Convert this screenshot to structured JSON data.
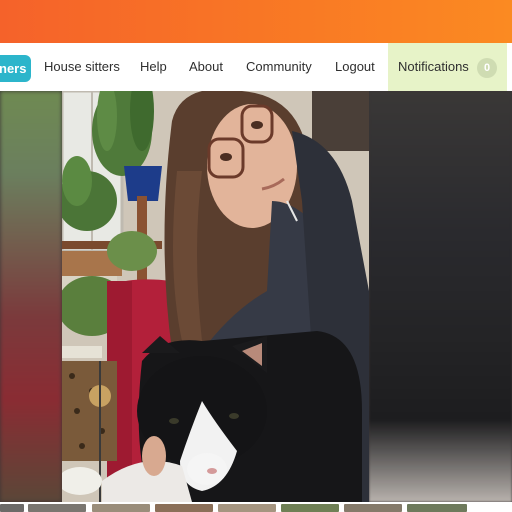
{
  "nav": {
    "active_item": "ners",
    "items": [
      {
        "label": "House sitters"
      },
      {
        "label": "Help"
      },
      {
        "label": "About"
      },
      {
        "label": "Community"
      },
      {
        "label": "Logout"
      }
    ],
    "notifications": {
      "label": "Notifications",
      "count": "0"
    }
  },
  "colors": {
    "brand_orange": "#f5622a",
    "accent_teal": "#2cb5cb",
    "notifications_bg": "#e7f3c8"
  },
  "photo": {
    "subject": "woman with glasses holding a black and white cat"
  },
  "thumbnails": {
    "count": 8
  }
}
